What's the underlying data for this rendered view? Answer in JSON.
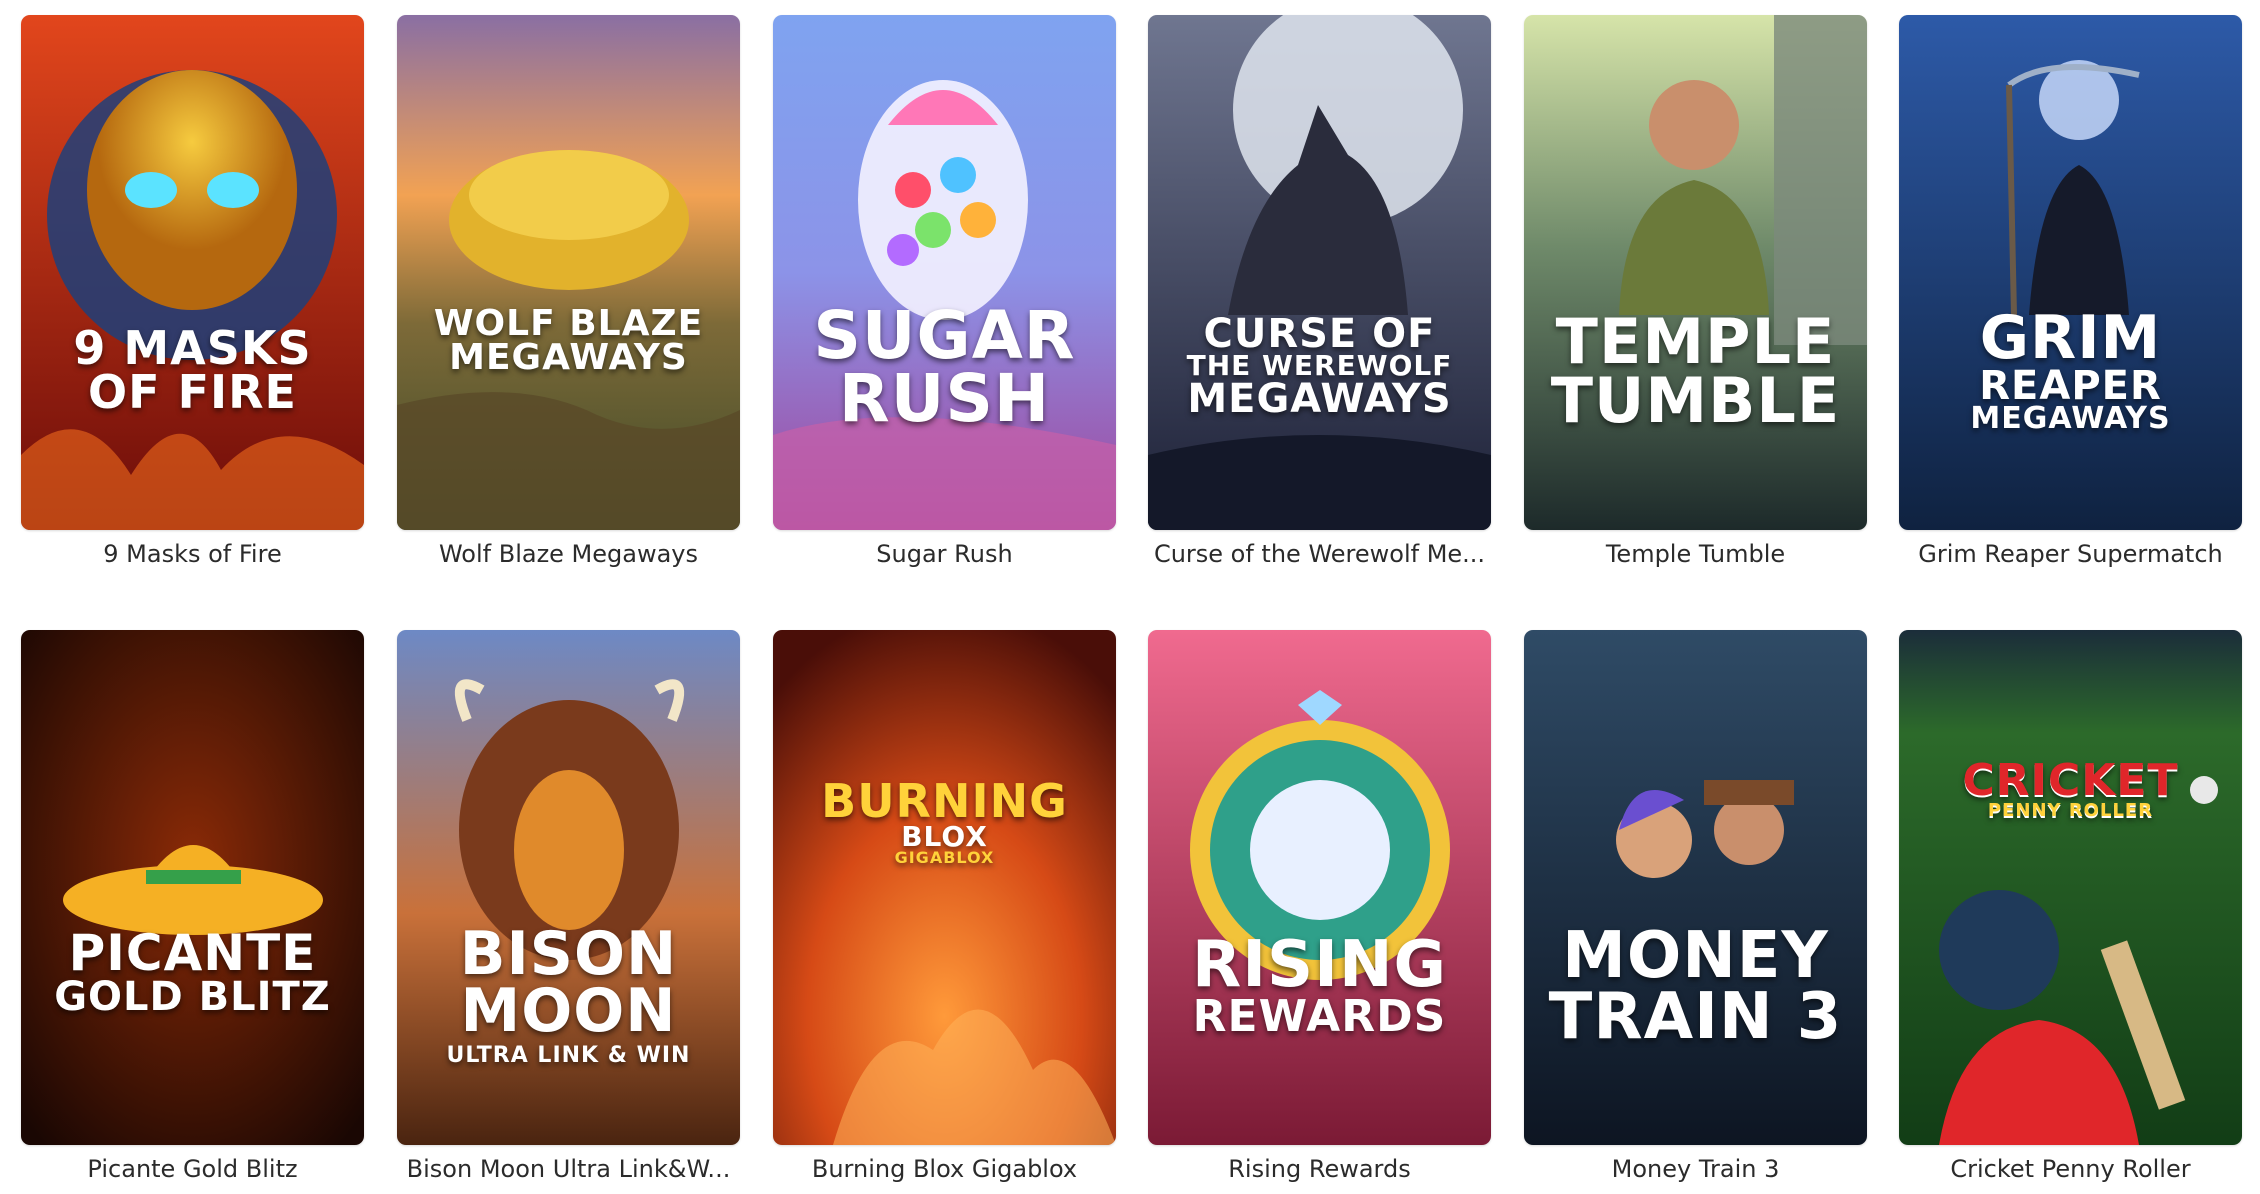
{
  "games": [
    {
      "caption": "9 Masks of Fire",
      "art": {
        "l1": "9 MASKS",
        "l2": "OF FIRE",
        "l3": ""
      },
      "colors": {
        "bg1": "#e2461c",
        "bg2": "#6b0c09",
        "accent": "#d9a21f"
      }
    },
    {
      "caption": "Wolf Blaze Megaways",
      "art": {
        "l1": "WOLF BLAZE",
        "l2": "MEGAWAYS",
        "l3": ""
      },
      "colors": {
        "bg1": "#8a6fa3",
        "bg2": "#3f4a28",
        "accent": "#e2b22c"
      }
    },
    {
      "caption": "Sugar Rush",
      "art": {
        "l1": "SUGAR",
        "l2": "RUSH",
        "l3": ""
      },
      "colors": {
        "bg1": "#8c93e8",
        "bg2": "#a0449a",
        "accent": "#ff77b7"
      }
    },
    {
      "caption": "Curse of the Werewolf Me...",
      "art": {
        "l1": "CURSE OF",
        "l2": "THE WEREWOLF",
        "l3": "MEGAWAYS"
      },
      "colors": {
        "bg1": "#6f7690",
        "bg2": "#1c2036",
        "accent": "#e9eef5"
      }
    },
    {
      "caption": "Temple Tumble",
      "art": {
        "l1": "TEMPLE",
        "l2": "TUMBLE",
        "l3": ""
      },
      "colors": {
        "bg1": "#b8c98a",
        "bg2": "#1d2a2a",
        "accent": "#6b7a3a"
      }
    },
    {
      "caption": "Grim Reaper Supermatch",
      "art": {
        "l1": "GRIM",
        "l2": "REAPER",
        "l3": "MEGAWAYS"
      },
      "colors": {
        "bg1": "#2d5aa8",
        "bg2": "#0f2240",
        "accent": "#cfe0ff"
      }
    },
    {
      "caption": "Picante Gold Blitz",
      "art": {
        "l1": "PICANTE",
        "l2": "GOLD BLITZ",
        "l3": ""
      },
      "colors": {
        "bg1": "#8a2a07",
        "bg2": "#1a0703",
        "accent": "#f5b024"
      }
    },
    {
      "caption": "Bison Moon Ultra Link&W...",
      "art": {
        "l1": "BISON",
        "l2": "MOON",
        "l3": "ULTRA LINK & WIN"
      },
      "colors": {
        "bg1": "#6d89c5",
        "bg2": "#4a2410",
        "accent": "#e08a2b"
      }
    },
    {
      "caption": "Burning Blox Gigablox",
      "art": {
        "l1": "BURNING",
        "l2": "BLOX",
        "l3": "GIGABLOX"
      },
      "colors": {
        "bg1": "#d64a16",
        "bg2": "#4a0e08",
        "accent": "#ffd23a"
      }
    },
    {
      "caption": "Rising Rewards",
      "art": {
        "l1": "RISING",
        "l2": "REWARDS",
        "l3": ""
      },
      "colors": {
        "bg1": "#f06a8f",
        "bg2": "#7b1a35",
        "accent": "#f2c33a"
      }
    },
    {
      "caption": "Money Train 3",
      "art": {
        "l1": "MONEY",
        "l2": "TRAIN 3",
        "l3": ""
      },
      "colors": {
        "bg1": "#2f4b66",
        "bg2": "#0d1522",
        "accent": "#6a4fd0"
      }
    },
    {
      "caption": "Cricket Penny Roller",
      "art": {
        "l1": "CRICKET",
        "l2": "PENNY ROLLER",
        "l3": ""
      },
      "colors": {
        "bg1": "#2c6a2a",
        "bg2": "#123d16",
        "accent": "#e0262a"
      }
    }
  ]
}
